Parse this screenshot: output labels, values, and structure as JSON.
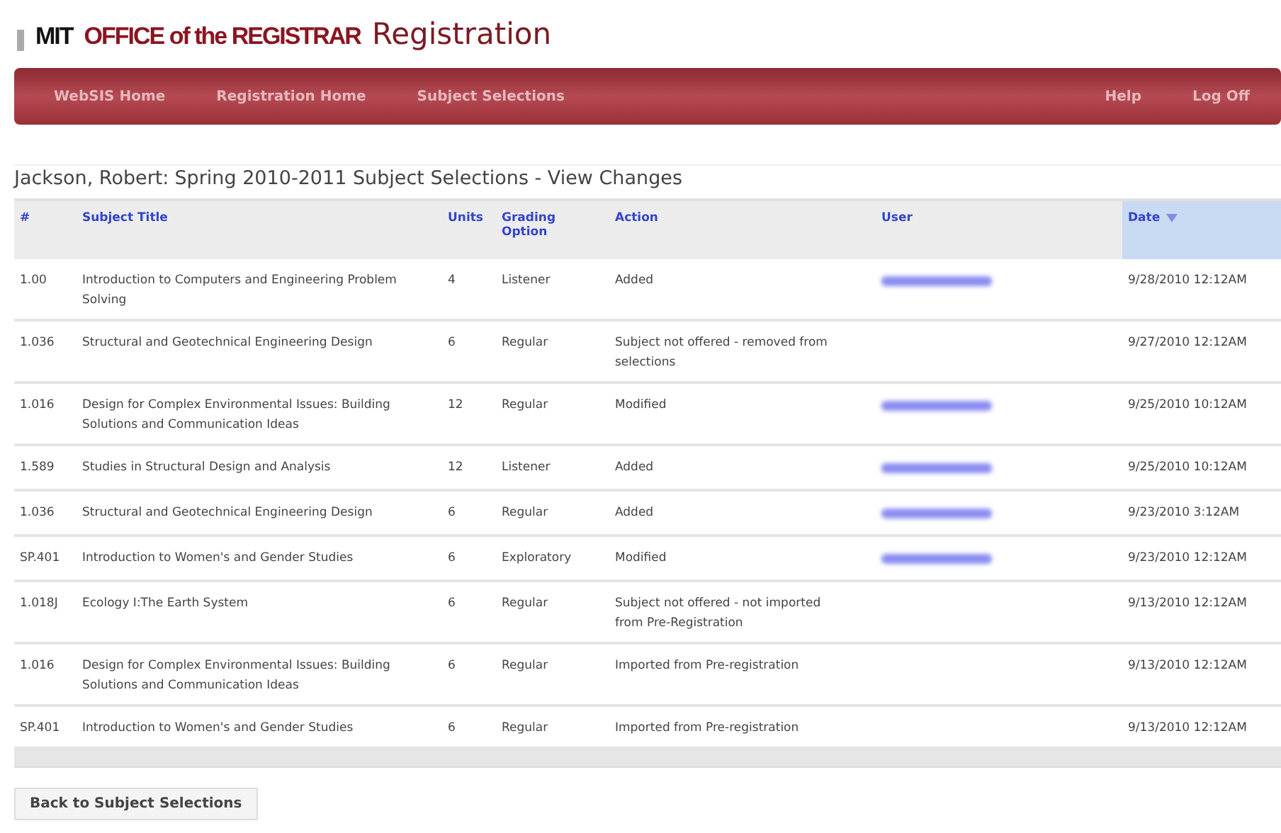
{
  "header": {
    "logo_mit": "MIT",
    "logo_office": "OFFICE of the REGISTRAR",
    "title": "Registration"
  },
  "nav": {
    "left": [
      "WebSIS Home",
      "Registration Home",
      "Subject Selections"
    ],
    "right": [
      "Help",
      "Log Off"
    ]
  },
  "page_title": {
    "name": "Jackson, Robert:",
    "rest": "Spring 2010-2011 Subject Selections - View Changes"
  },
  "table": {
    "columns": [
      {
        "label": "#",
        "sorted": false
      },
      {
        "label": "Subject Title",
        "sorted": false
      },
      {
        "label": "Units",
        "sorted": false
      },
      {
        "label": "Grading Option",
        "sorted": false
      },
      {
        "label": "Action",
        "sorted": false
      },
      {
        "label": "User",
        "sorted": false
      },
      {
        "label": "Date",
        "sorted": true
      }
    ],
    "rows": [
      {
        "number": "1.00",
        "title": "Introduction to Computers and Engineering Problem Solving",
        "units": "4",
        "grading": "Listener",
        "action": "Added",
        "user_redacted": true,
        "date": "9/28/2010 12:12AM"
      },
      {
        "number": "1.036",
        "title": "Structural and Geotechnical Engineering Design",
        "units": "6",
        "grading": "Regular",
        "action": "Subject not offered - removed from selections",
        "user_redacted": false,
        "date": "9/27/2010 12:12AM"
      },
      {
        "number": "1.016",
        "title": "Design for Complex Environmental Issues: Building Solutions and Communication  Ideas",
        "units": "12",
        "grading": "Regular",
        "action": "Modified",
        "user_redacted": true,
        "date": "9/25/2010 10:12AM"
      },
      {
        "number": "1.589",
        "title": "Studies in Structural Design and Analysis",
        "units": "12",
        "grading": "Listener",
        "action": "Added",
        "user_redacted": true,
        "date": "9/25/2010 10:12AM"
      },
      {
        "number": "1.036",
        "title": "Structural and Geotechnical Engineering Design",
        "units": "6",
        "grading": "Regular",
        "action": "Added",
        "user_redacted": true,
        "date": "9/23/2010 3:12AM"
      },
      {
        "number": "SP.401",
        "title": "Introduction to Women's and Gender Studies",
        "units": "6",
        "grading": "Exploratory",
        "action": "Modified",
        "user_redacted": true,
        "date": "9/23/2010 12:12AM"
      },
      {
        "number": "1.018J",
        "title": "Ecology I:The Earth System",
        "units": "6",
        "grading": "Regular",
        "action": "Subject not offered - not imported from Pre-Registration",
        "user_redacted": false,
        "date": "9/13/2010 12:12AM"
      },
      {
        "number": "1.016",
        "title": "Design for Complex Environmental Issues: Building Solutions and Communication  Ideas",
        "units": "6",
        "grading": "Regular",
        "action": "Imported from Pre-registration",
        "user_redacted": false,
        "date": "9/13/2010 12:12AM"
      },
      {
        "number": "SP.401",
        "title": "Introduction to Women's and Gender Studies",
        "units": "6",
        "grading": "Regular",
        "action": "Imported from Pre-registration",
        "user_redacted": false,
        "date": "9/13/2010 12:12AM"
      }
    ]
  },
  "back_button": "Back to Subject Selections"
}
